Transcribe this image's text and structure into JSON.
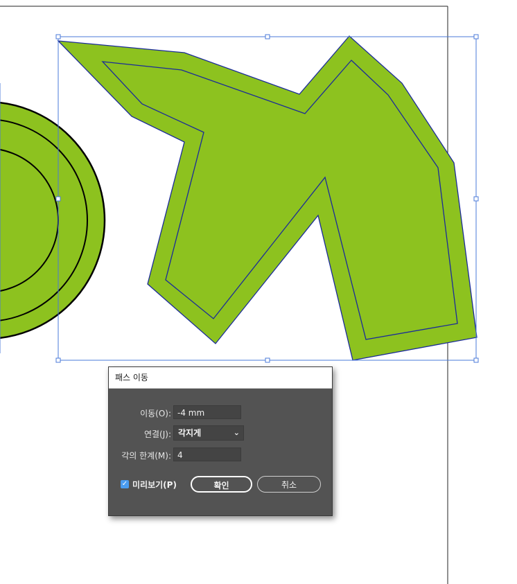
{
  "colors": {
    "shape_fill": "#8dc21f",
    "path_stroke": "#1a2a9a",
    "selection": "#4a78d8",
    "dialog_bg": "#535353",
    "accent": "#4a9cf0"
  },
  "dialog": {
    "title": "패스 이동",
    "offset": {
      "label": "이동(O):",
      "value": "-4 mm"
    },
    "joins": {
      "label": "연결(J):",
      "value": "각지게"
    },
    "miter_limit": {
      "label": "각의 한계(M):",
      "value": "4"
    },
    "preview": {
      "label": "미리보기(P)",
      "checked": true
    },
    "ok_label": "확인",
    "cancel_label": "취소"
  }
}
